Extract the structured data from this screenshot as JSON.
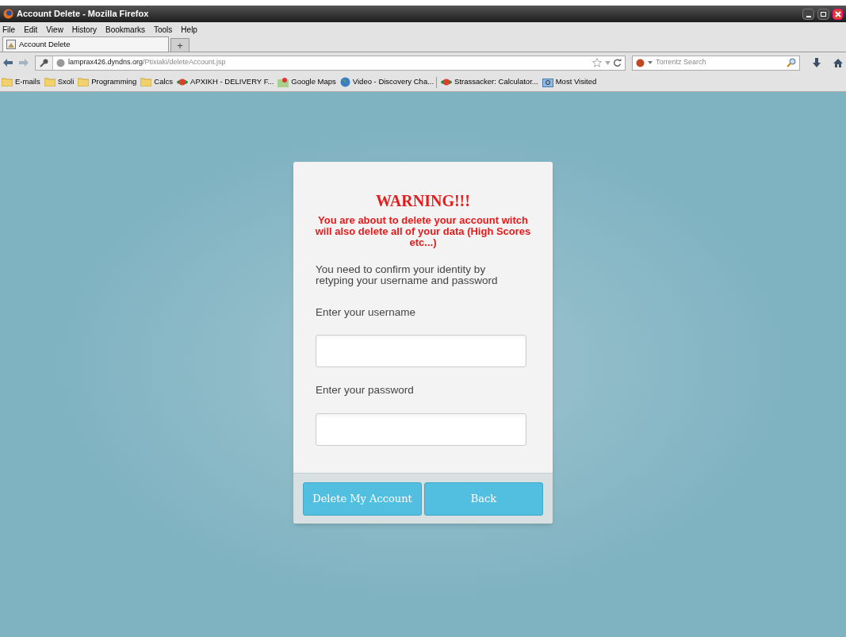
{
  "window": {
    "title": "Account Delete - Mozilla Firefox"
  },
  "menu": [
    "File",
    "Edit",
    "View",
    "History",
    "Bookmarks",
    "Tools",
    "Help"
  ],
  "tabs": [
    {
      "label": "Account Delete",
      "selected": true
    }
  ],
  "new_tab": "+",
  "address_bar": {
    "host": "lamprax426.dyndns.org",
    "path": "/Ptixiaki/deleteAccount.jsp"
  },
  "search": {
    "placeholder": "Torrentz Search"
  },
  "bookmarks": [
    {
      "label": "E-mails",
      "kind": "folder"
    },
    {
      "label": "Sxoli",
      "kind": "folder"
    },
    {
      "label": "Programming",
      "kind": "folder"
    },
    {
      "label": "Calcs",
      "kind": "folder"
    },
    {
      "label": "APXIKH - DELIVERY F...",
      "kind": "site"
    },
    {
      "label": "Google Maps",
      "kind": "map"
    },
    {
      "label": "Video - Discovery Cha...",
      "kind": "globe"
    },
    {
      "kind": "separator"
    },
    {
      "label": "Strassacker: Calculator...",
      "kind": "site"
    },
    {
      "label": "Most Visited",
      "kind": "search"
    }
  ],
  "page": {
    "heading": "WARNING!!!",
    "warning": "You are about to delete your account witch will also delete all of your data (High Scores etc...)",
    "instructions": "You need to confirm your identity by retyping your username and password",
    "fields": [
      {
        "label": "Enter your username"
      },
      {
        "label": "Enter your password"
      }
    ],
    "buttons": [
      "Delete My Account",
      "Back"
    ]
  }
}
